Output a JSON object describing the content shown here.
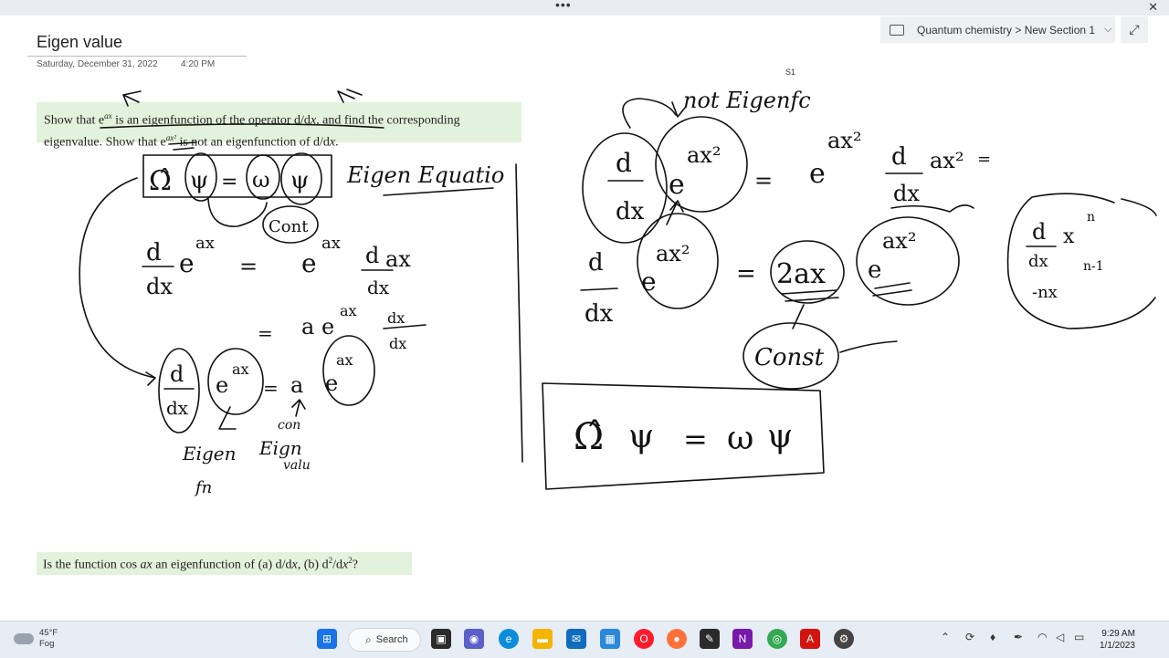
{
  "window": {
    "more_glyph": "•••",
    "close_glyph": "✕"
  },
  "notebook": {
    "breadcrumb": "Quantum chemistry > New Section 1",
    "chevron": "⌵",
    "expand_glyph": "⤢",
    "page_marker": "S1"
  },
  "page": {
    "title": "Eigen value",
    "date": "Saturday, December 31, 2022",
    "time": "4:20 PM"
  },
  "question1": {
    "p1": "Show that ",
    "e": "e",
    "exp1": "ax",
    "p2": " is an eigenfunction of the operator d/d",
    "x": "x",
    "p3": ", and find the corresponding eigenvalue. Show that e",
    "exp2": "ax²",
    "p4": " is not an eigenfunction of d/d",
    "p5": "."
  },
  "question2": {
    "p1": "Is the function cos ",
    "ax": "ax",
    "p2": " an eigenfunction of (a) d/d",
    "x": "x",
    "p3": ", (b) d",
    "sq": "2",
    "p4": "/d",
    "p5": "?"
  },
  "handwriting": {
    "eigen_equation": "Eigen Equatio",
    "not_eigenfunction": "not Eigenfc",
    "cont": "Cont",
    "const": "Const",
    "eigen": "Eigen",
    "fn": "fn",
    "con": "con",
    "eign": "Eign",
    "valu": "valu"
  },
  "taskbar": {
    "weather_temp": "45°F",
    "weather_cond": "Fog",
    "search_label": "Search",
    "time": "9:29 AM",
    "date": "1/1/2023",
    "icons": [
      "windows-start-icon",
      "file-explorer-icon",
      "edge-icon",
      "mail-icon",
      "store-icon",
      "opera-icon",
      "firefox-icon",
      "onenote-icon",
      "chrome-icon",
      "acrobat-icon"
    ],
    "colors": {
      "start": "#1a73e8",
      "onenote": "#7719aa",
      "acrobat": "#d3140e",
      "opera": "#ff1b2d"
    }
  }
}
